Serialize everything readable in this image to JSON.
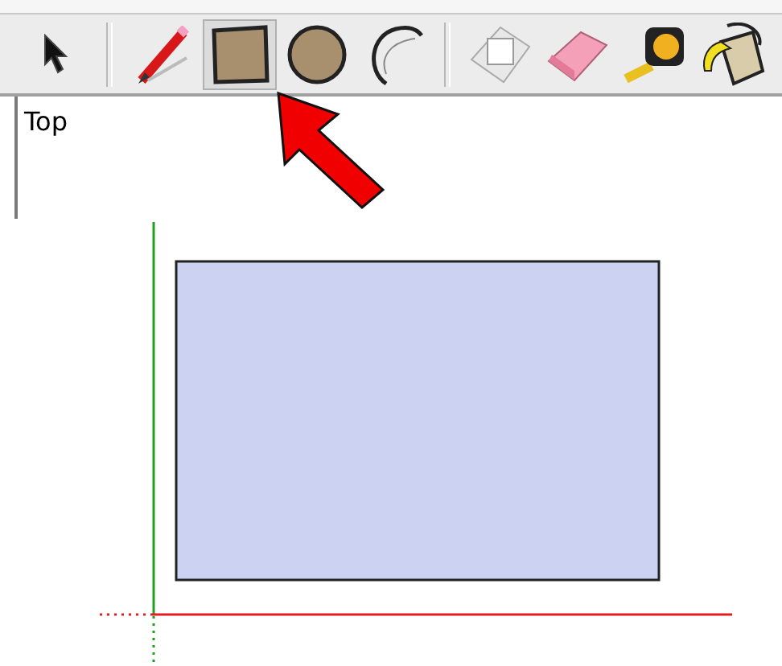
{
  "toolbar": {
    "tools": [
      {
        "kind": "select",
        "selected": false
      },
      {
        "kind": "separator",
        "selected": false
      },
      {
        "kind": "pencil",
        "selected": false
      },
      {
        "kind": "rectangle",
        "selected": true
      },
      {
        "kind": "circle",
        "selected": false
      },
      {
        "kind": "arc",
        "selected": false
      },
      {
        "kind": "separator",
        "selected": false
      },
      {
        "kind": "pushpull",
        "selected": false
      },
      {
        "kind": "eraser",
        "selected": false
      },
      {
        "kind": "tape",
        "selected": false
      },
      {
        "kind": "paint",
        "selected": false
      }
    ]
  },
  "viewport": {
    "view_label": "Top"
  }
}
